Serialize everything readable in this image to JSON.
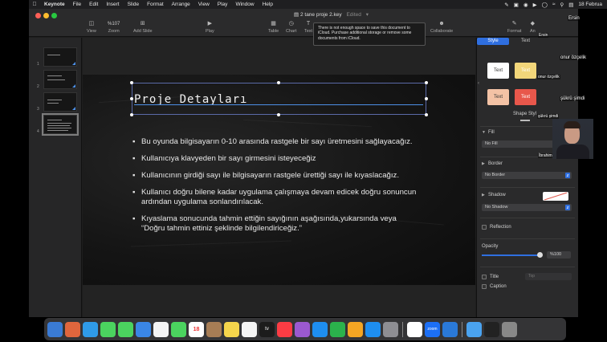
{
  "menubar": {
    "app": "Keynote",
    "items": [
      "File",
      "Edit",
      "Insert",
      "Slide",
      "Format",
      "Arrange",
      "View",
      "Play",
      "Window",
      "Help"
    ],
    "clock": "18 Februa"
  },
  "window": {
    "doc_title": "2 tane proje 2.key",
    "edited": "Edited",
    "toolbar": {
      "view": "View",
      "zoom_value": "%107",
      "zoom": "Zoom",
      "add_slide": "Add Slide",
      "play": "Play",
      "table": "Table",
      "chart": "Chart",
      "text": "Text",
      "collaborate": "Collaborate",
      "format": "Format",
      "animate": "An"
    }
  },
  "tooltip": "There is not enough space to save this document to iCloud. Purchase additional storage or remove some documents from iCloud.",
  "navigator": {
    "slide_numbers": [
      "1",
      "2",
      "3",
      "4"
    ],
    "selected": 4
  },
  "slide": {
    "title": "Proje Detayları",
    "bullets": [
      "Bu oyunda bilgisayarın 0-10 arasında rastgele bir sayı üretmesini sağlayacağız.",
      "Kullanıcıya  klavyeden bir sayı girmesini isteyeceğiz",
      "Kullanıcının girdiği sayı ile bilgisayarın rastgele ürettiği sayı ile kıyaslacağız.",
      "Kullanıcı doğru bilene kadar uygulama çalışmaya devam edicek doğru sonuncun ardından uygulama sonlandırılacak.",
      "Kıyaslama sonucunda tahmin ettiğin sayığının aşağısında,yukarsında veya “Doğru tahmin ettiniz şeklinde bilgilendiriceğiz.”"
    ]
  },
  "inspector": {
    "tab_style": "Style",
    "tab_text": "Text",
    "swatches": [
      {
        "label": "Text",
        "bg": "#ffffff",
        "fg": "#333333"
      },
      {
        "label": "Text",
        "bg": "#f2d67a",
        "fg": "#ffffff"
      },
      {
        "label": "Text",
        "bg": "#f3c2a5",
        "fg": "#333333"
      },
      {
        "label": "Text",
        "bg": "#e8574b",
        "fg": "#ffffff"
      }
    ],
    "shape_styles": "Shape Styl",
    "fill_label": "Fill",
    "fill_value": "No Fill",
    "border_label": "Border",
    "border_value": "No Border",
    "shadow_label": "Shadow",
    "shadow_value": "No Shadow",
    "reflection": "Reflection",
    "opacity_label": "Opacity",
    "opacity_value": "%100",
    "opacity_fraction": 1.0,
    "title_label": "Title",
    "title_popup": "Top",
    "caption_label": "Caption"
  },
  "participants": {
    "names": [
      "Ersin",
      "Ersin",
      "onur özçelik",
      "onur özçelik",
      "şükrü şimdi",
      "şükrü şimdi",
      "İbrahim Özsoy"
    ]
  },
  "dock": {
    "calendar_day": "18",
    "zoom_label": "zoom",
    "tv_label": "tv",
    "icon_colors": [
      "#3a7bd5",
      "#e0663d",
      "#2f9be8",
      "#4bd35f",
      "#4bd35f",
      "#3a86e6",
      "#f4f4f4",
      "#4bd35f",
      "#ffffff",
      "#a77d55",
      "#f5d54c",
      "#f5f5f5",
      "#1c1c1c",
      "#fc3c44",
      "#9b59d0",
      "#1e8ef0",
      "#2bb24c",
      "#f5a623",
      "#1e8ef0",
      "#8e8e93",
      "#ffffff",
      "#1c6ff5",
      "#2a79d8",
      "#4aa3f0",
      "#222222",
      "#888888"
    ]
  }
}
